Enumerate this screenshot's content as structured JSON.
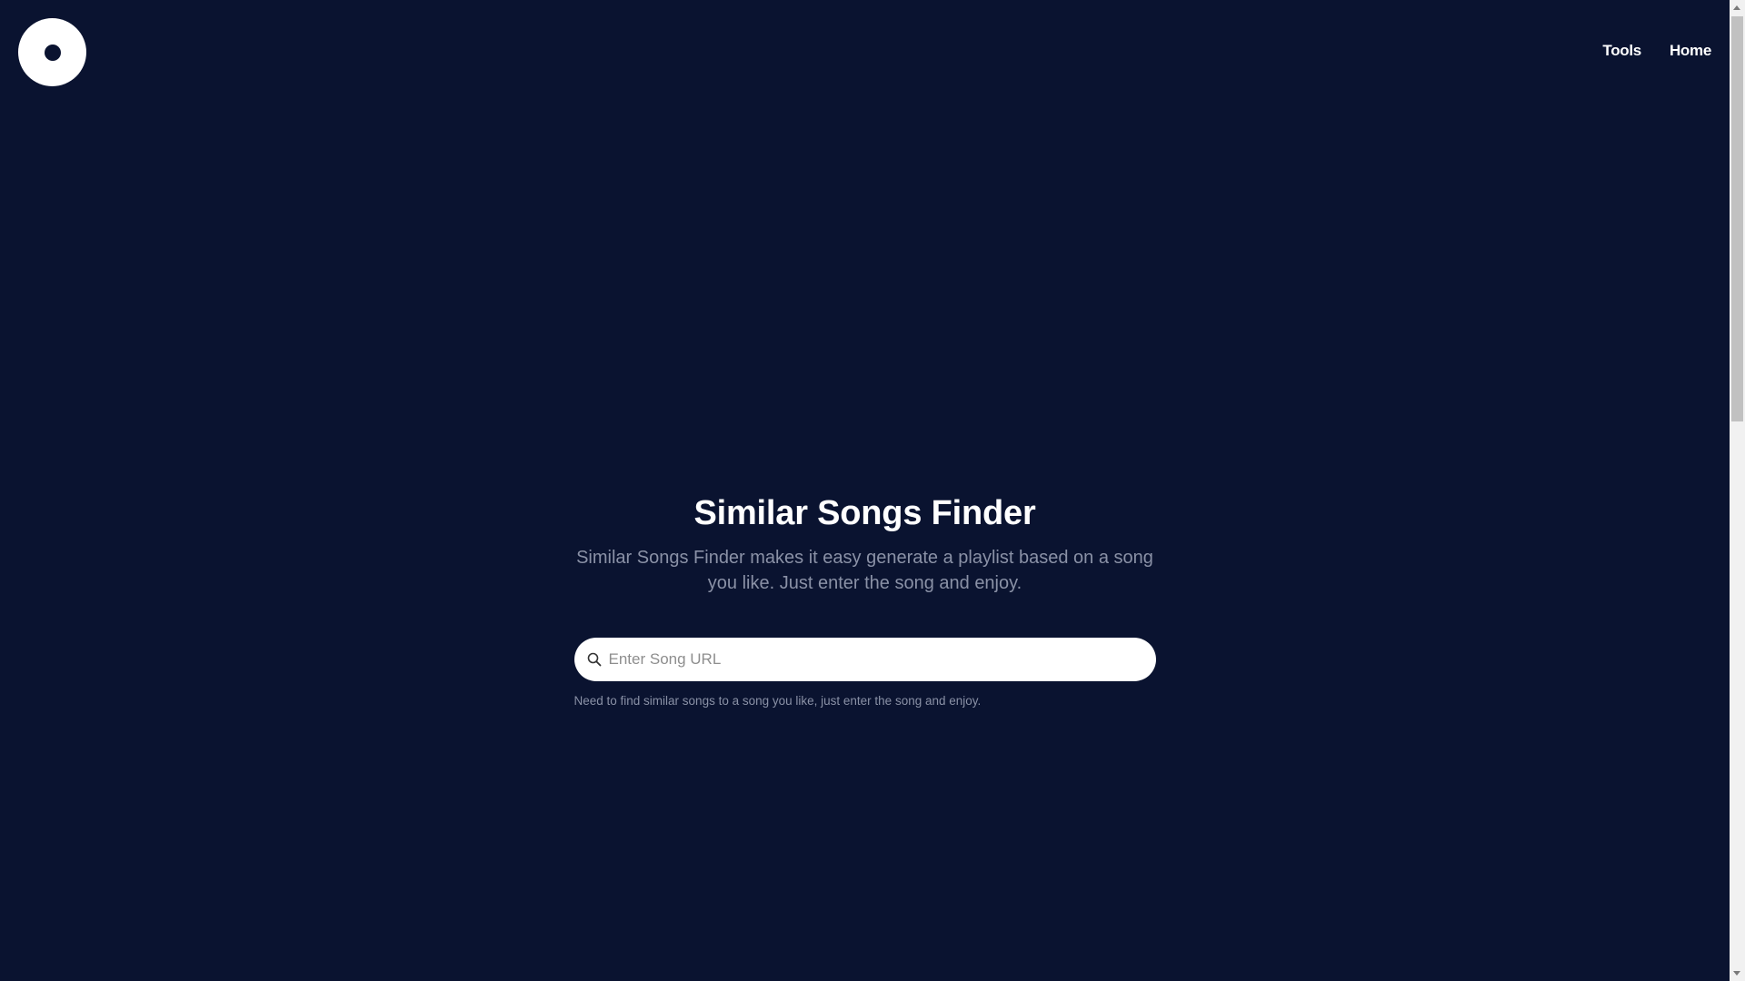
{
  "header": {
    "logo_icon": "vinyl-record-icon",
    "nav": [
      {
        "label": "Tools"
      },
      {
        "label": "Home"
      }
    ]
  },
  "hero": {
    "title": "Similar Songs Finder",
    "subtitle": "Similar Songs Finder makes it easy generate a playlist based on a song you like. Just enter the song and enjoy.",
    "search": {
      "placeholder": "Enter Song URL",
      "value": "",
      "icon": "search-icon"
    },
    "hint": "Need to find similar songs to a song you like, just enter the song and enjoy."
  },
  "colors": {
    "background": "#0a1330",
    "text": "#ffffff",
    "muted": "#8a91a6"
  }
}
